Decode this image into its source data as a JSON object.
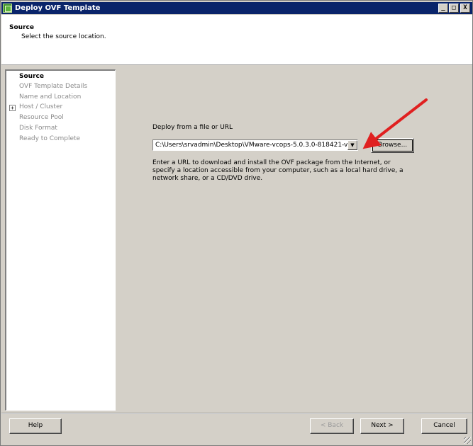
{
  "window": {
    "title": "Deploy OVF Template",
    "controls": [
      "_",
      "□",
      "X"
    ]
  },
  "header": {
    "title": "Source",
    "subtitle": "Select the source location."
  },
  "nav": {
    "items": [
      {
        "label": "Source",
        "active": true
      },
      {
        "label": "OVF Template Details",
        "active": false
      },
      {
        "label": "Name and Location",
        "active": false
      },
      {
        "label": "Host / Cluster",
        "active": false,
        "expandable": true,
        "expander": "+"
      },
      {
        "label": "Resource Pool",
        "active": false
      },
      {
        "label": "Disk Format",
        "active": false
      },
      {
        "label": "Ready to Complete",
        "active": false
      }
    ]
  },
  "main": {
    "field_label": "Deploy from a file or URL",
    "path_value": "C:\\Users\\srvadmin\\Desktop\\VMware-vcops-5.0.3.0-818421-v",
    "dropdown_glyph": "▼",
    "browse_label": "Browse...",
    "description": "Enter a URL to download and install the OVF package from the Internet, or specify a location accessible from your computer, such as a local hard drive, a network share, or a CD/DVD drive."
  },
  "footer": {
    "help_label": "Help",
    "back_label": "< Back",
    "next_label": "Next >",
    "cancel_label": "Cancel"
  },
  "annotation": {
    "arrow_color": "#e02020"
  },
  "colors": {
    "titlebar": "#0a246a",
    "face": "#d4d0c8",
    "disabled_text": "#8a8a8a"
  }
}
